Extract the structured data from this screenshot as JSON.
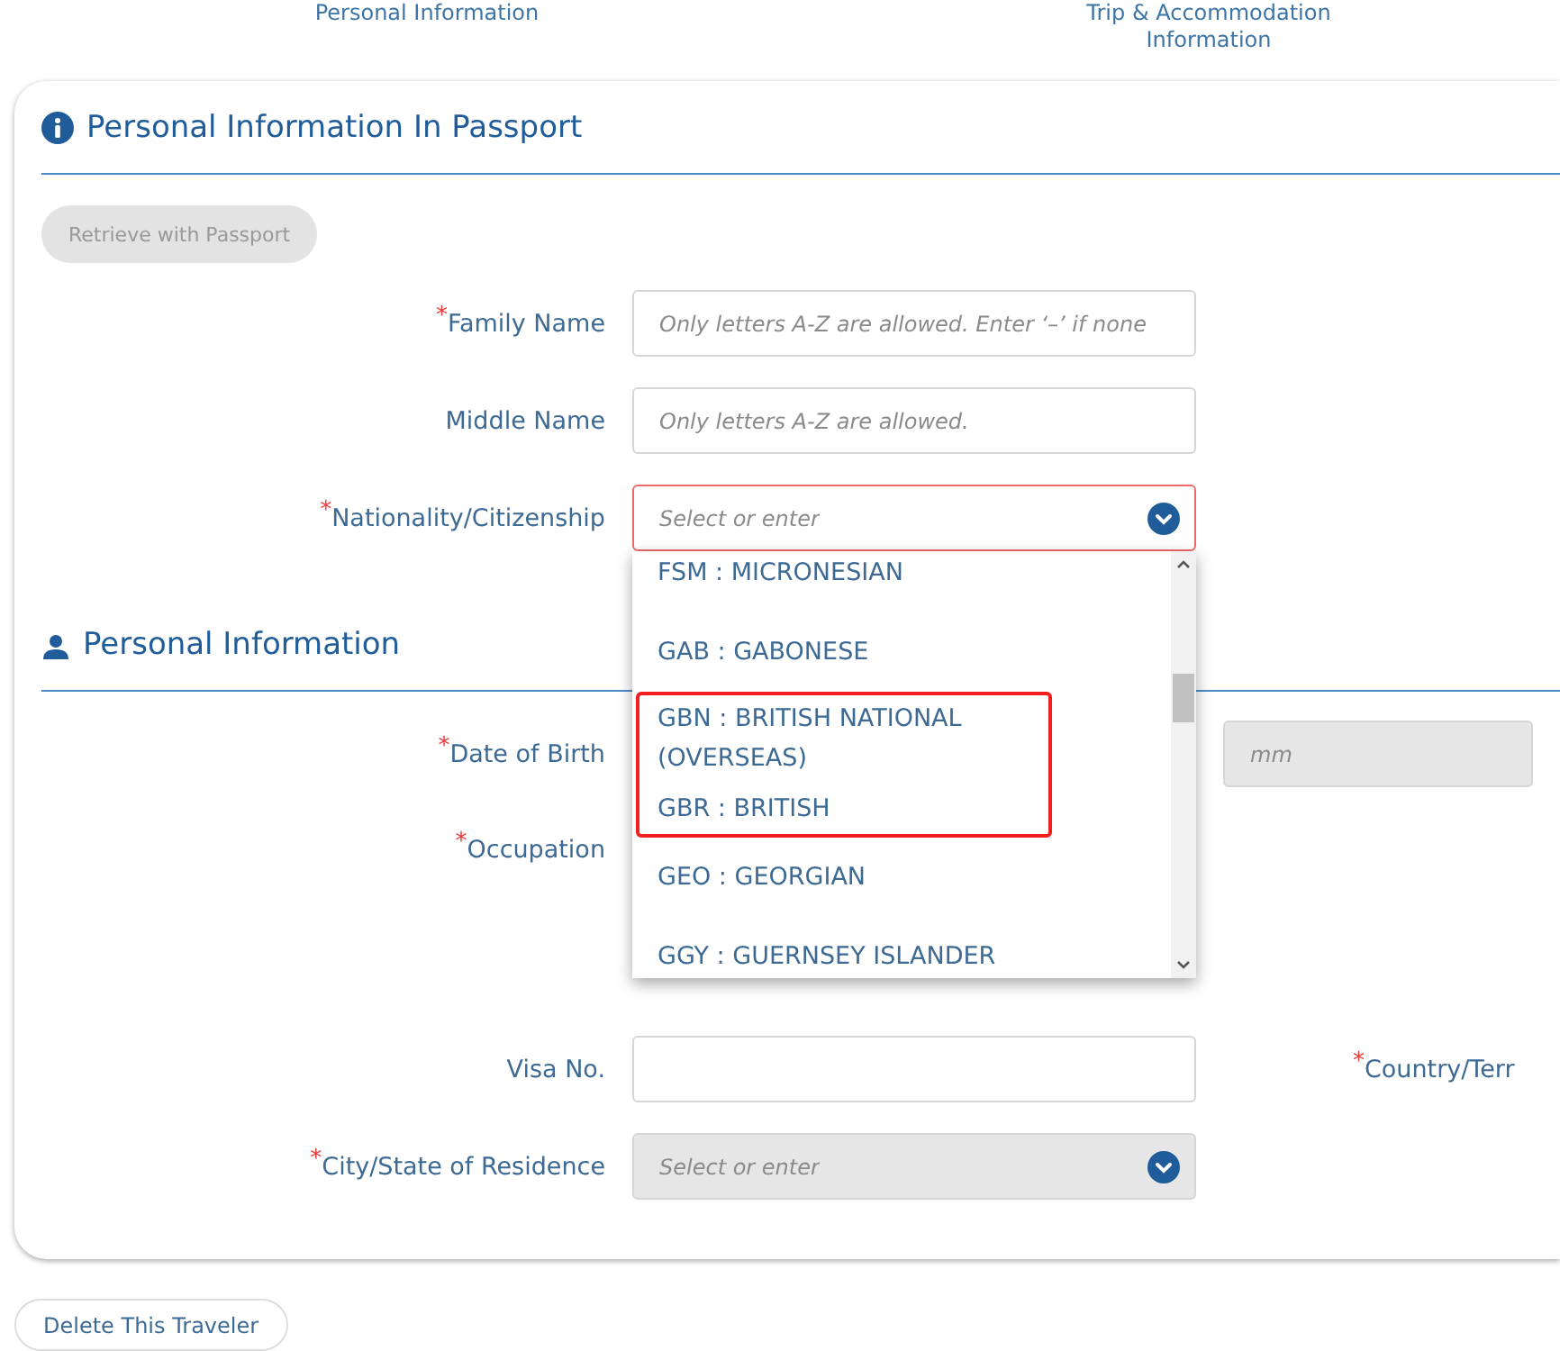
{
  "steps": [
    {
      "label": "Personal Information"
    },
    {
      "label": "Trip & Accommodation Information"
    }
  ],
  "sections": [
    {
      "title": "Personal Information In Passport",
      "button": {
        "label": "Retrieve with Passport",
        "disabled": true
      },
      "fields": [
        {
          "kind": "text",
          "marker": "*",
          "label": "Family Name",
          "placeholder": "Only letters A-Z are allowed. Enter ‘–’ if none",
          "invalid": false
        },
        {
          "kind": "text",
          "label": "Middle Name",
          "placeholder": "Only letters A-Z are allowed.",
          "invalid": false
        },
        {
          "kind": "select",
          "marker": "*",
          "label": "Nationality/Citizenship",
          "placeholder": "Select or enter",
          "invalid": true,
          "disabled": false,
          "expanded": true,
          "options": [
            {
              "text": "FSM : MICRONESIAN",
              "highlighted": false
            },
            {
              "text": "GAB : GABONESE",
              "highlighted": false
            },
            {
              "text": "GBN : BRITISH NATIONAL (OVERSEAS)",
              "highlighted": true
            },
            {
              "text": "GBR : BRITISH",
              "highlighted": true
            },
            {
              "text": "GEO : GEORGIAN",
              "highlighted": false
            },
            {
              "text": "GGY : GUERNSEY ISLANDER",
              "highlighted": false
            }
          ]
        }
      ]
    },
    {
      "title": "Personal Information",
      "fields": [
        {
          "kind": "covered",
          "marker": "*",
          "label": "Date of Birth",
          "extra": {
            "kind": "field",
            "placeholder": "mm",
            "disabled": true
          }
        },
        {
          "kind": "covered",
          "marker": "*",
          "label": "Occupation"
        },
        {
          "kind": "text",
          "label": "Visa No.",
          "invalid": false,
          "extra": {
            "kind": "label",
            "marker": "*",
            "label": "Country/Terr"
          }
        },
        {
          "kind": "select",
          "marker": "*",
          "label": "City/State of Residence",
          "placeholder": "Select or enter",
          "invalid": false,
          "disabled": true
        }
      ]
    }
  ],
  "footer_button": {
    "label": "Delete This Traveler"
  }
}
